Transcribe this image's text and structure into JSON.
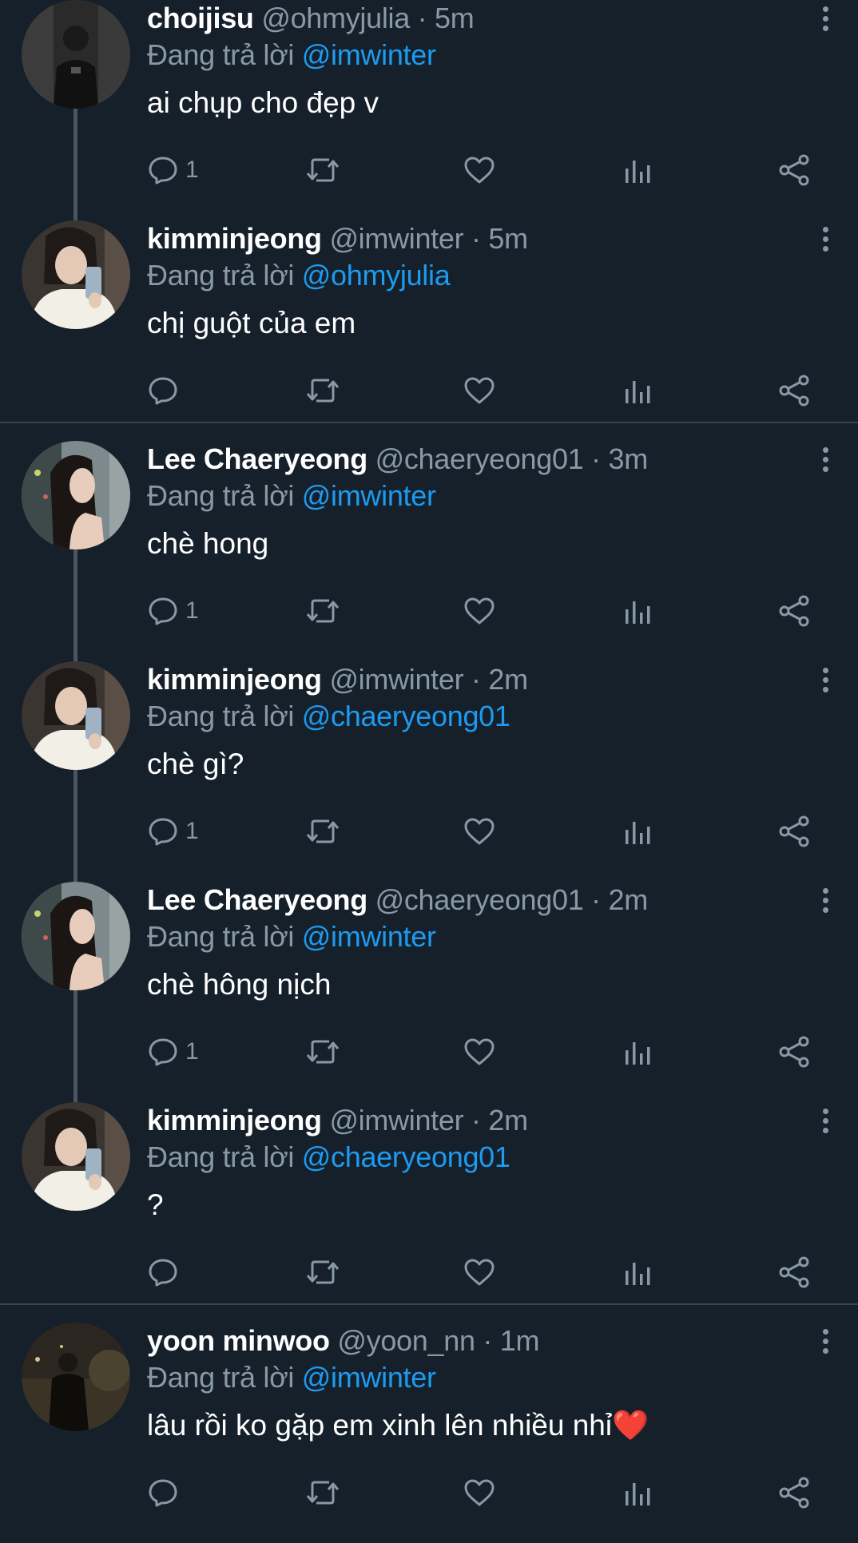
{
  "colors": {
    "background": "#15202b",
    "text_primary": "#ffffff",
    "text_secondary": "#8899a6",
    "mention": "#1d9bf0",
    "divider": "#38444d",
    "thread_line": "#4a5561"
  },
  "reply_prefix": "Đang trả lời",
  "tweets": [
    {
      "display_name": "choijisu",
      "handle": "@ohmyjulia",
      "time": "5m",
      "replying_to": "@imwinter",
      "text": "ai chụp cho đẹp v",
      "reply_count": "1",
      "avatar": "dark"
    },
    {
      "display_name": "kimminjeong",
      "handle": "@imwinter",
      "time": "5m",
      "replying_to": "@ohmyjulia",
      "text": "chị guột của em",
      "reply_count": "",
      "avatar": "mirror"
    },
    {
      "display_name": "Lee Chaeryeong",
      "handle": "@chaeryeong01",
      "time": "3m",
      "replying_to": "@imwinter",
      "text": "chè hong",
      "reply_count": "1",
      "avatar": "portrait"
    },
    {
      "display_name": "kimminjeong",
      "handle": "@imwinter",
      "time": "2m",
      "replying_to": "@chaeryeong01",
      "text": "chè gì?",
      "reply_count": "1",
      "avatar": "mirror"
    },
    {
      "display_name": "Lee Chaeryeong",
      "handle": "@chaeryeong01",
      "time": "2m",
      "replying_to": "@imwinter",
      "text": "chè hông nịch",
      "reply_count": "1",
      "avatar": "portrait"
    },
    {
      "display_name": "kimminjeong",
      "handle": "@imwinter",
      "time": "2m",
      "replying_to": "@chaeryeong01",
      "text": "?",
      "reply_count": "",
      "avatar": "mirror"
    },
    {
      "display_name": "yoon minwoo",
      "handle": "@yoon_nn",
      "time": "1m",
      "replying_to": "@imwinter",
      "text": "lâu rồi ko gặp em xinh lên nhiều nhỉ",
      "emoji": "❤️",
      "reply_count": "",
      "avatar": "night"
    }
  ],
  "icons": [
    "reply-icon",
    "retweet-icon",
    "like-icon",
    "analytics-icon",
    "share-icon",
    "more-options-icon"
  ]
}
